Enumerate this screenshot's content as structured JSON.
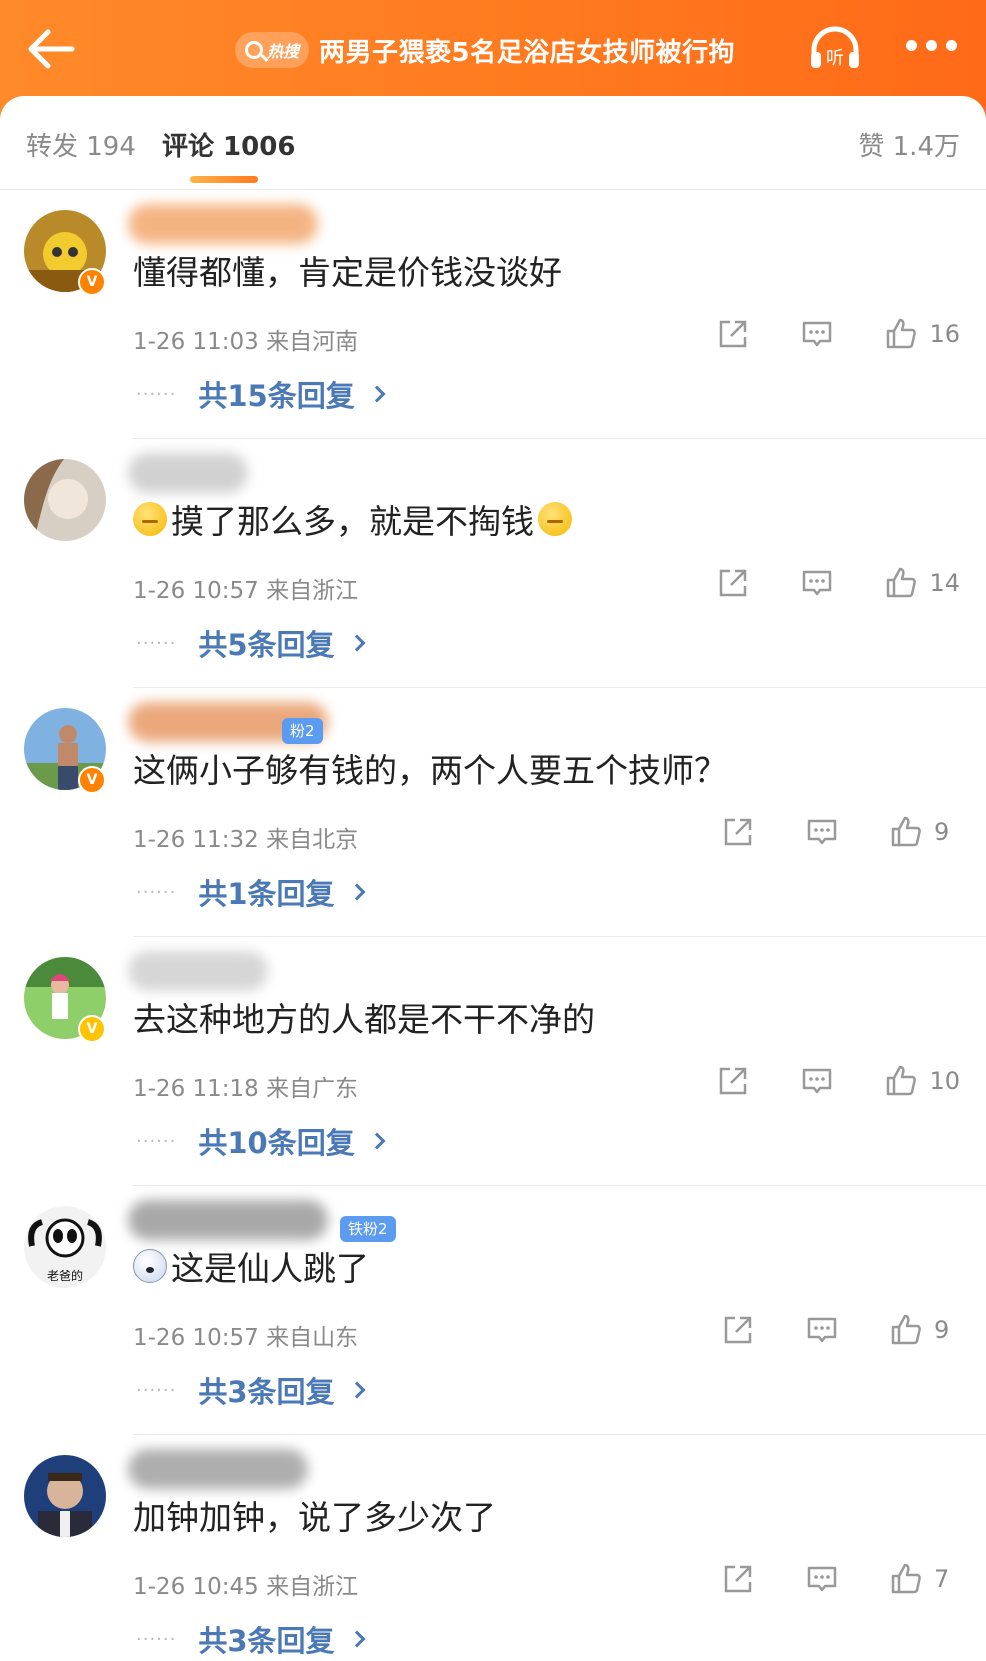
{
  "header": {
    "hot_label": "热搜",
    "title": "两男子猥亵5名足浴店女技师被行拘",
    "listen_label": "听"
  },
  "tabs": {
    "repost": "转发 194",
    "comments": "评论 1006",
    "likes": "赞 1.4万"
  },
  "colors": {
    "accent": "#ff7a1e",
    "link": "#4a79b6",
    "fan_badge": "#5b9bf0"
  },
  "comments": [
    {
      "text": "懂得都懂，肯定是价钱没谈好",
      "meta": "1-26 11:03 来自河南",
      "likes": "16",
      "replies": "共15条回复",
      "badge": "orange"
    },
    {
      "text": "摸了那么多，就是不掏钱",
      "meta": "1-26 10:57 来自浙江",
      "likes": "14",
      "replies": "共5条回复",
      "emoji": "shush-emoji"
    },
    {
      "text": "这俩小子够有钱的，两个人要五个技师？",
      "meta": "1-26 11:32 来自北京",
      "likes": "9",
      "replies": "共1条回复",
      "badge": "orange",
      "fan_badge": "粉2"
    },
    {
      "text": "去这种地方的人都是不干不净的",
      "meta": "1-26 11:18 来自广东",
      "likes": "10",
      "replies": "共10条回复",
      "badge": "yellow"
    },
    {
      "text": "这是仙人跳了",
      "meta": "1-26 10:57 来自山东",
      "likes": "9",
      "replies": "共3条回复",
      "fan_badge": "铁粉2",
      "avatar_text": "老爸的",
      "emoji": "ghost-emoji"
    },
    {
      "text": "加钟加钟，说了多少次了",
      "meta": "1-26 10:45 来自浙江",
      "likes": "7",
      "replies": "共3条回复"
    }
  ]
}
